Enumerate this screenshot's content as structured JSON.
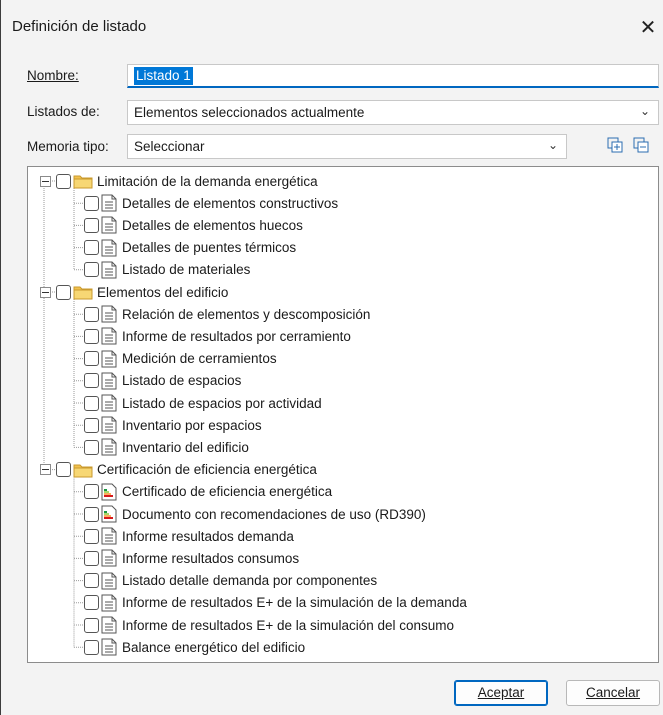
{
  "window": {
    "title": "Definición de listado",
    "close_glyph": "✕"
  },
  "form": {
    "nombre_label": "Nombre:",
    "nombre_value": "Listado 1",
    "listados_label": "Listados de:",
    "listados_value": "Elementos seleccionados actualmente",
    "memoria_label": "Memoria tipo:",
    "memoria_value": "Seleccionar"
  },
  "tree": [
    {
      "label": "Limitación de la demanda energética",
      "icon": "folder-icon",
      "children": [
        {
          "label": "Detalles de elementos constructivos",
          "icon": "document-icon"
        },
        {
          "label": "Detalles de elementos huecos",
          "icon": "document-icon"
        },
        {
          "label": "Detalles de puentes térmicos",
          "icon": "document-icon"
        },
        {
          "label": "Listado de materiales",
          "icon": "document-icon"
        }
      ]
    },
    {
      "label": "Elementos del edificio",
      "icon": "folder-icon",
      "children": [
        {
          "label": "Relación de elementos y descomposición",
          "icon": "document-icon"
        },
        {
          "label": "Informe de resultados por cerramiento",
          "icon": "document-icon"
        },
        {
          "label": "Medición de cerramientos",
          "icon": "document-icon"
        },
        {
          "label": "Listado de espacios",
          "icon": "document-icon"
        },
        {
          "label": "Listado de espacios por actividad",
          "icon": "document-icon"
        },
        {
          "label": "Inventario por espacios",
          "icon": "document-icon"
        },
        {
          "label": "Inventario del edificio",
          "icon": "document-icon"
        }
      ]
    },
    {
      "label": "Certificación de eficiencia energética",
      "icon": "folder-icon",
      "children": [
        {
          "label": "Certificado de eficiencia energética",
          "icon": "energy-label-icon"
        },
        {
          "label": "Documento con recomendaciones de uso (RD390)",
          "icon": "energy-label-icon"
        },
        {
          "label": "Informe resultados demanda",
          "icon": "document-icon"
        },
        {
          "label": "Informe resultados consumos",
          "icon": "document-icon"
        },
        {
          "label": "Listado detalle demanda por componentes",
          "icon": "document-icon"
        },
        {
          "label": "Informe de resultados E+ de la simulación de la demanda",
          "icon": "document-icon"
        },
        {
          "label": "Informe de resultados E+ de la simulación del consumo",
          "icon": "document-icon"
        },
        {
          "label": "Balance energético del edificio",
          "icon": "document-icon"
        }
      ]
    }
  ],
  "buttons": {
    "accept": "Aceptar",
    "cancel": "Cancelar"
  }
}
